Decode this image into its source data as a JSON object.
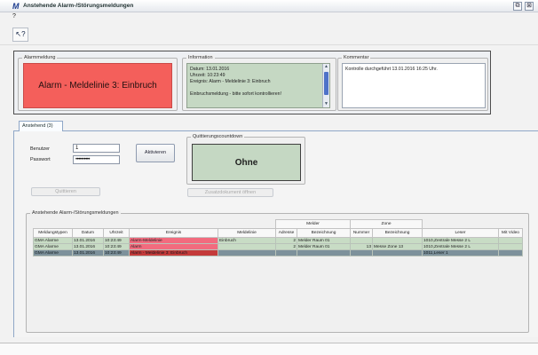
{
  "window": {
    "logo": "M",
    "title": "Anstehende Alarm-/Störungsmeldungen",
    "restore_glyph": "⧉",
    "close_glyph": "⊠"
  },
  "menu": {
    "help": "?"
  },
  "toolbar": {
    "whatsthis_glyph": "↖?"
  },
  "alarm": {
    "group_label": "Alarmmeldung",
    "text": "Alarm - Meldelinie 3: Einbruch",
    "color": "#f45f5b"
  },
  "information": {
    "group_label": "Information",
    "lines": [
      "Datum: 13.01.2016",
      "Uhrzeit: 10:23:49",
      "Ereignis: Alarm - Meldelinie 3: Einbruch",
      "",
      "Einbruchsmeldung - bitte sofort kontrollieren!"
    ]
  },
  "comment": {
    "group_label": "Kommentar",
    "text": "Kontrolle durchgeführt 13.01.2016 16:25 Uhr."
  },
  "tabs": [
    {
      "label": "Anstehend (3)"
    }
  ],
  "login": {
    "user_label": "Benutzer",
    "user_value": "1",
    "password_label": "Passwort",
    "password_value": "••••••••••",
    "activate_button": "Aktivieren",
    "acknowledge_button": "Quittieren"
  },
  "countdown": {
    "group_label": "Quittierungscountdown",
    "value": "Ohne",
    "color": "#c5d8c3",
    "doc_button": "Zusatzdokument öffnen"
  },
  "table": {
    "group_label": "Anstehende Alarm-/Störungsmeldungen",
    "group_headers": {
      "melder": "Melder",
      "zone": "Zone"
    },
    "columns": [
      "Meldungstypen",
      "Datum",
      "Uhrzeit",
      "Ereignis",
      "Meldelinie",
      "Adresse",
      "Bezeichnung",
      "Nummer",
      "Bezeichnung",
      "Leser",
      "Mit Video"
    ],
    "rows": [
      [
        "GMA Alarme",
        "13.01.2016",
        "10:23:49",
        "Alarm-Meldelinie",
        "Einbruch",
        "2",
        "Melder Raum 01",
        "",
        "",
        "1010,Zentrale Messe 2 L",
        ""
      ],
      [
        "GMA Alarme",
        "13.01.2016",
        "10:23:49",
        "Alarm",
        "",
        "2",
        "Melder Raum 01",
        "13",
        "Messe Zone 13",
        "1010,Zentrale Messe 2 L",
        ""
      ],
      [
        "GMA Alarme",
        "13.01.2016",
        "10:23:49",
        "Alarm - Meldelinie 3: Einbruch",
        "",
        "",
        "",
        "",
        "",
        "1011,Leser 1",
        ""
      ]
    ]
  }
}
